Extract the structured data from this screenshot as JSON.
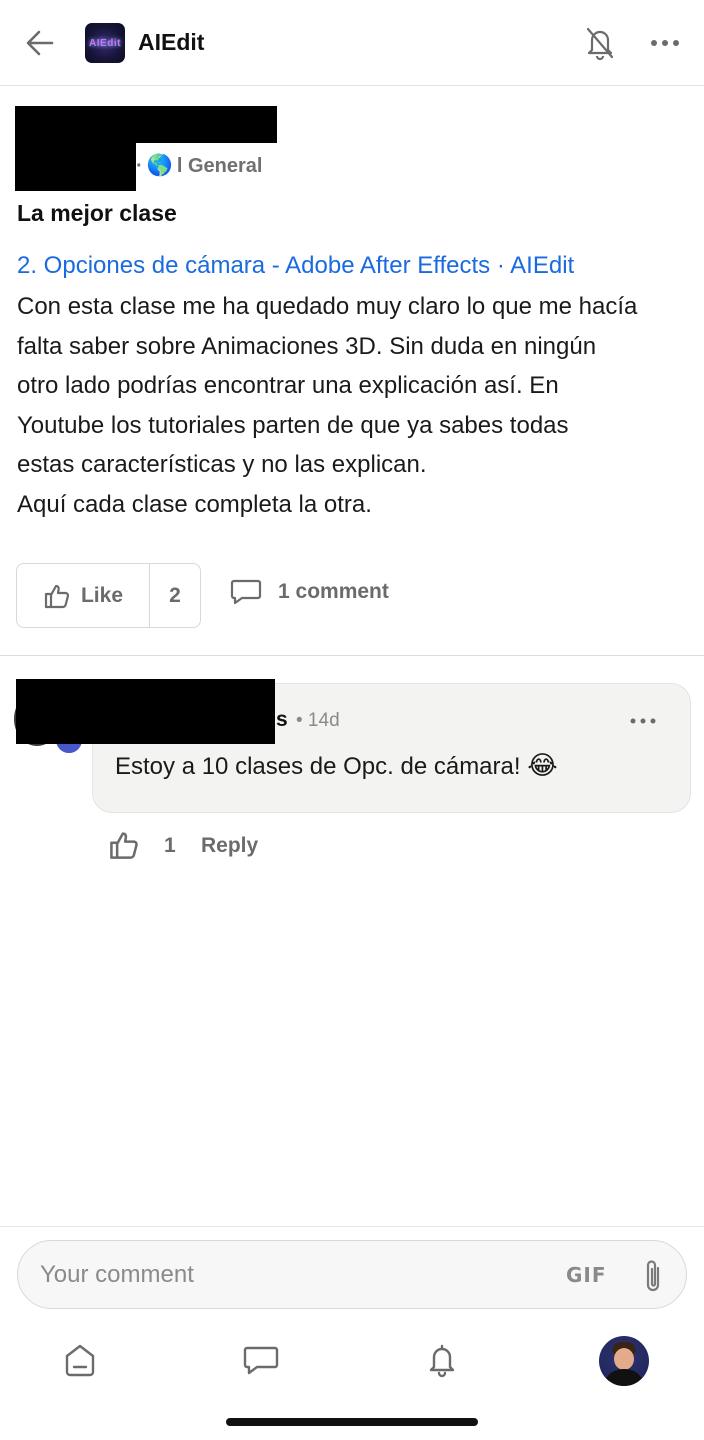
{
  "header": {
    "app_name": "AIEdit",
    "logo_text": "AIEdit",
    "back_icon": "arrow-left-icon",
    "notifications_icon": "bell-off-icon",
    "more_icon": "more-horizontal-icon"
  },
  "post": {
    "category_emoji": "🌎",
    "category": "l General",
    "title": "La mejor clase",
    "link_text": "2. Opciones de cámara - Adobe After Effects · AIEdit",
    "body_lines": [
      "Con esta clase me ha quedado muy claro lo que me hacía",
      "falta saber sobre Animaciones 3D. Sin duda en ningún",
      "otro lado podrías encontrar una explicación así. En",
      "Youtube los tutoriales parten de que ya sabes todas",
      "estas características y no las explican.",
      "Aquí cada clase completa la otra."
    ],
    "like_label": "Like",
    "like_count": "2",
    "comment_count_label": "1 comment"
  },
  "comment": {
    "author_visible_tail": "s",
    "time": "• 14d",
    "text": "Estoy a 10 clases de Opc. de cámara!",
    "emoji": "😂",
    "like_count": "1",
    "reply_label": "Reply"
  },
  "composer": {
    "placeholder": "Your comment",
    "gif_label": "GIF",
    "attach_icon": "paperclip-icon"
  },
  "bottom_nav": {
    "items": [
      "home-icon",
      "chat-icon",
      "bell-icon",
      "profile-avatar"
    ]
  },
  "colors": {
    "link": "#1a6be0",
    "muted_text": "#6b6b6b",
    "bubble_bg": "#f3f3f2"
  }
}
